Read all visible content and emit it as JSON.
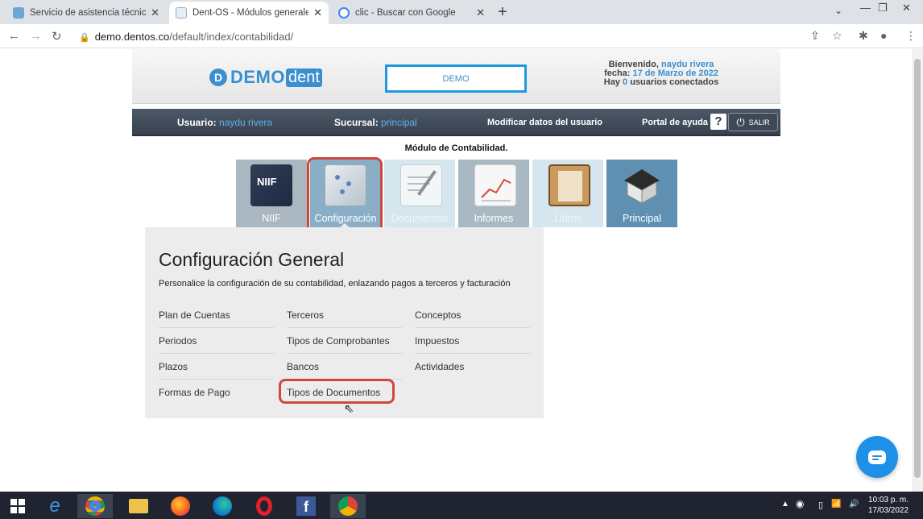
{
  "browser": {
    "tabs": [
      {
        "title": "Servicio de asistencia técnica : Sy",
        "active": false
      },
      {
        "title": "Dent-OS - Módulos generales",
        "active": true
      },
      {
        "title": "clic - Buscar con Google",
        "active": false
      }
    ],
    "url_host": "demo.dentos.co",
    "url_path": "/default/index/contabilidad/"
  },
  "header": {
    "logo_part1": "DEMO",
    "logo_part2": "dent",
    "logo_initial": "D",
    "demo_label": "DEMO",
    "welcome_prefix": "Bienvenido,",
    "welcome_user": "naydu rivera",
    "date_prefix": "fecha:",
    "date_value": "17 de Marzo de 2022",
    "users_prefix": "Hay",
    "users_count": "0",
    "users_suffix": "usuarios conectados"
  },
  "navbar": {
    "user_label": "Usuario:",
    "user_value": "naydu rivera",
    "branch_label": "Sucursal:",
    "branch_value": "principal",
    "modify_label": "Modificar datos del usuario",
    "help_label": "Portal de ayuda",
    "help_icon": "?",
    "logout_label": "SALIR"
  },
  "module_title": "Módulo de Contabilidad.",
  "tiles": [
    {
      "label": "NIIF",
      "icon": "niif-book-icon",
      "selected": false
    },
    {
      "label": "Configuración",
      "icon": "settings-panel-icon",
      "selected": true
    },
    {
      "label": "Documentos",
      "icon": "document-pen-icon",
      "selected": false
    },
    {
      "label": "Informes",
      "icon": "report-chart-icon",
      "selected": false
    },
    {
      "label": "Libros",
      "icon": "ledger-book-icon",
      "selected": false
    },
    {
      "label": "Principal",
      "icon": "home-icon",
      "selected": false
    }
  ],
  "panel": {
    "title": "Configuración General",
    "description": "Personalice la configuración de su contabilidad, enlazando pagos a terceros y facturación",
    "columns": [
      [
        "Plan de Cuentas",
        "Periodos",
        "Plazos",
        "Formas de Pago"
      ],
      [
        "Terceros",
        "Tipos de Comprobantes",
        "Bancos",
        "Tipos de Documentos"
      ],
      [
        "Conceptos",
        "Impuestos",
        "Actividades"
      ]
    ]
  },
  "taskbar": {
    "time": "10:03 p. m.",
    "date": "17/03/2022"
  },
  "colors": {
    "accent": "#3a8fd0",
    "highlight_ring": "#d0473e",
    "navbar": "#404a57",
    "panel_bg": "#ececec"
  }
}
